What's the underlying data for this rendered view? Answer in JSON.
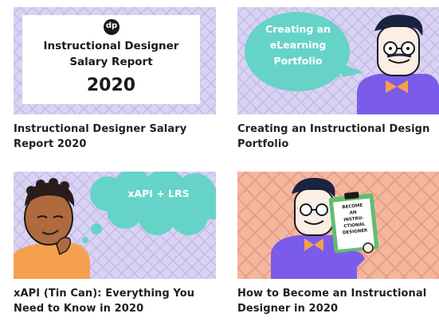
{
  "cards": [
    {
      "title": "Instructional Designer Salary Report 2020",
      "thumb": {
        "logo": "dp",
        "heading_line1": "Instructional Designer",
        "heading_line2": "Salary Report",
        "year": "2020"
      }
    },
    {
      "title": "Creating an Instructional Design Portfolio",
      "thumb": {
        "bubble_line1": "Creating an",
        "bubble_line2": "eLearning",
        "bubble_line3": "Portfolio"
      }
    },
    {
      "title": "xAPI (Tin Can): Everything You Need to Know in 2020",
      "thumb": {
        "bubble": "xAPI + LRS"
      }
    },
    {
      "title": "How to Become an Instructional Designer in 2020",
      "thumb": {
        "sign_line1": "BECOME",
        "sign_line2": "AN",
        "sign_line3": "INSTRU-",
        "sign_line4": "CTIONAL",
        "sign_line5": "DESIGNER"
      }
    }
  ],
  "colors": {
    "lavender": "#d9d3f2",
    "lavender_pattern": "#c4baeb",
    "teal": "#66d3c8",
    "purple": "#7b5ce8",
    "peach": "#f3b79f",
    "peach_pattern": "#e89e84",
    "orange": "#f5a04e",
    "title_text": "#1f1f1f"
  }
}
